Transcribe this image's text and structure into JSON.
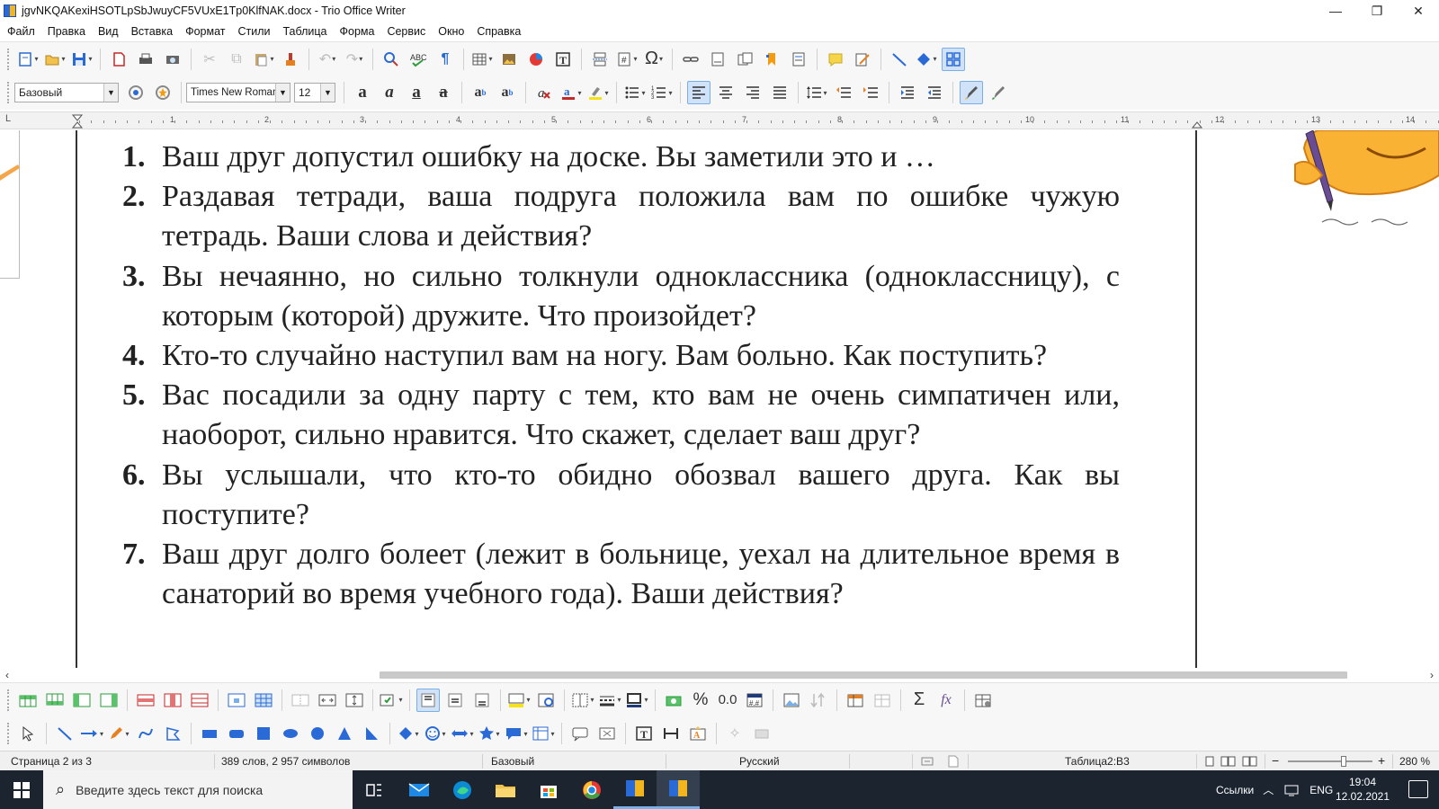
{
  "window": {
    "title": "jgvNKQAKexiHSOTLpSbJwuyCF5VUxE1Tp0KlfNAK.docx - Trio Office Writer",
    "controls": [
      "—",
      "❐",
      "✕"
    ]
  },
  "menu": [
    "Файл",
    "Правка",
    "Вид",
    "Вставка",
    "Формат",
    "Стили",
    "Таблица",
    "Форма",
    "Сервис",
    "Окно",
    "Справка"
  ],
  "format_bar": {
    "paragraph_style": "Базовый",
    "font_name": "Times New Roman",
    "font_size": "12"
  },
  "ruler": {
    "marker": "L",
    "numbers": [
      "1",
      "2",
      "3",
      "4",
      "5",
      "6",
      "7",
      "8",
      "9",
      "10",
      "11",
      "12",
      "13",
      "14"
    ]
  },
  "document": {
    "items": [
      {
        "num": "1.",
        "text": "Ваш друг допустил ошибку на доске. Вы заметили это и …"
      },
      {
        "num": "2.",
        "text": "Раздавая тетради, ваша подруга положила вам по ошибке чужую тетрадь. Ваши слова и действия?"
      },
      {
        "num": "3.",
        "text": "Вы нечаянно, но сильно толкнули одноклассника (одноклассницу), с которым (которой) дружите. Что произойдет?"
      },
      {
        "num": "4.",
        "text": "Кто-то случайно наступил вам на ногу. Вам больно. Как поступить?"
      },
      {
        "num": "5.",
        "text": "Вас посадили за одну парту с тем, кто вам не очень симпатичен или, наоборот, сильно нравится. Что скажет, сделает ваш друг?"
      },
      {
        "num": "6.",
        "text": "Вы услышали, что кто-то обидно обозвал вашего друга. Как вы поступите?"
      },
      {
        "num": "7.",
        "text": "Ваш друг долго болеет (лежит в больнице, уехал на длительное время в санаторий во время учебного года). Ваши действия?"
      }
    ]
  },
  "statusbar": {
    "page": "Страница 2 из 3",
    "words": "389 слов, 2 957 символов",
    "style": "Базовый",
    "language": "Русский",
    "cell": "Таблица2:B3",
    "zoom": "280 %"
  },
  "taskbar": {
    "search_placeholder": "Введите здесь текст для поиска",
    "links_label": "Ссылки",
    "lang": "ENG",
    "time": "19:04",
    "date": "12.02.2021"
  },
  "colors": {
    "accent": "#2a6ad6",
    "taskbar": "#1c2430",
    "active_button": "#cfe2f8"
  }
}
